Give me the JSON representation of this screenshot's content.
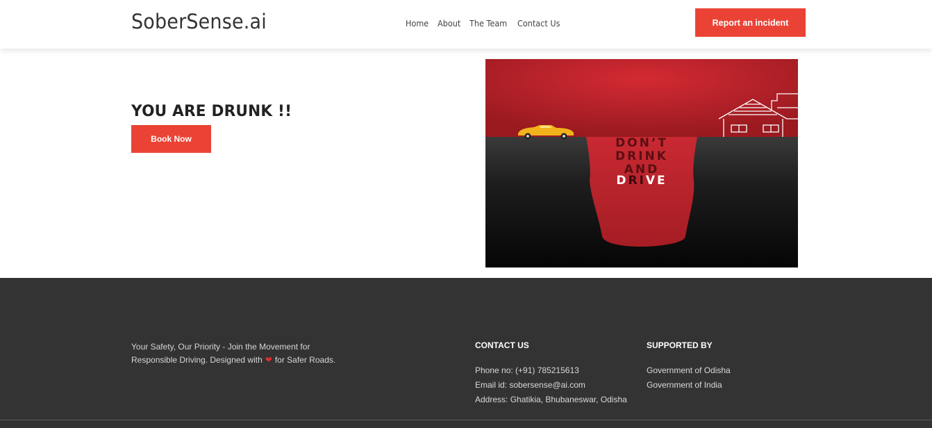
{
  "header": {
    "logo": "SoberSense.ai",
    "nav": [
      "Home",
      "About",
      "The Team",
      "Contact Us"
    ],
    "report_button": "Report an incident"
  },
  "hero": {
    "title": "YOU ARE DRUNK !!",
    "book_button": "Book Now",
    "poster": {
      "line1": "DON’T",
      "line2": "DRINK",
      "line3": "AND",
      "line4_start": "D",
      "line4_mid": "RI",
      "line4_end": "VE"
    }
  },
  "footer": {
    "tagline_part1": "Your Safety, Our Priority - Join the Movement for Responsible Driving. Designed with",
    "tagline_part2": "for Safer Roads.",
    "contact": {
      "title": "CONTACT US",
      "items": [
        "Phone no: (+91) 785215613",
        "Email id: sobersense@ai.com",
        "Address: Ghatikia, Bhubaneswar, Odisha"
      ]
    },
    "supported": {
      "title": "SUPPORTED BY",
      "items": [
        "Government of Odisha",
        "Government of India"
      ]
    }
  },
  "colors": {
    "accent": "#ea4335",
    "footer_bg": "#333333",
    "poster_red": "#c0242c"
  }
}
